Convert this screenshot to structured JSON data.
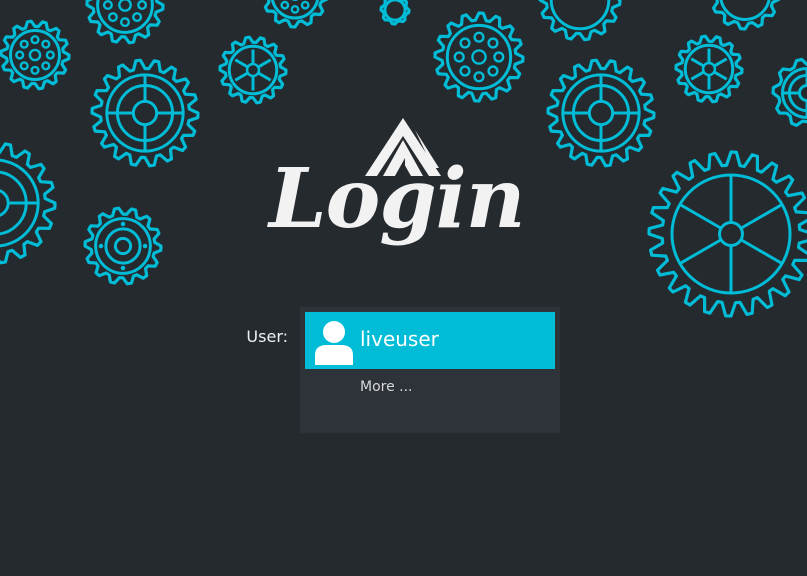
{
  "theme": {
    "background": "#252a2f",
    "accent": "#00bcd6",
    "panel": "#2d3339",
    "text": "#f0f0f0"
  },
  "logo": {
    "wordmark": "Login",
    "mark_icon": "arch-linux-logo-icon"
  },
  "login": {
    "user_label": "User:",
    "selected_user": "liveuser",
    "avatar_icon": "user-avatar-icon",
    "more_label": "More ..."
  },
  "background": {
    "decoration_icon": "gear-icon"
  }
}
